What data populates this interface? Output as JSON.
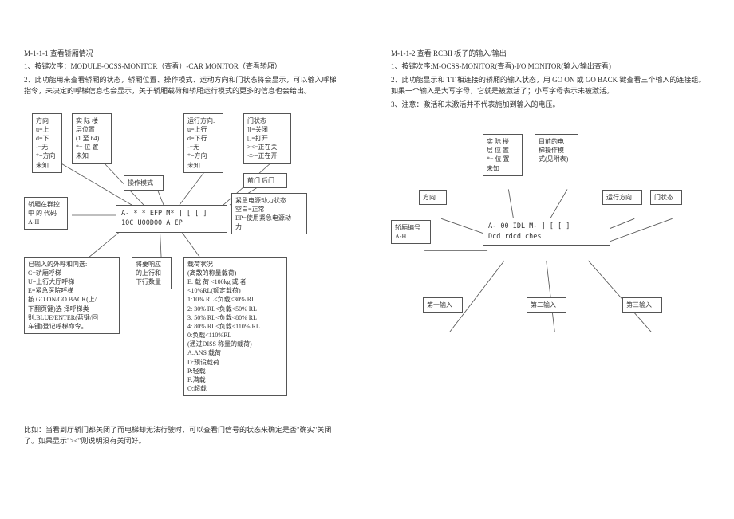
{
  "left": {
    "title": "M-1-1-1 查看轿厢情况",
    "line1": "1、按键次序：MODULE-OCSS-MONITOR（查看）-CAR MONITOR（查看轿厢）",
    "line2": "2、此功能用来查看轿厢的状态，轿厢位置、操作模式、运动方向和门状态将会显示，可以输入呼梯指令，未决定的呼梯信息也会显示，关于轿厢载荷和轿厢运行模式的更多的信息也会给出。",
    "box_direction": "方向\nu=上\nd=下\n-=无\n*=方向\n未知",
    "box_floor": "实 际 楼\n层位置\n(1 至 64)\n*= 位 置\n未知",
    "box_opmode": "操作模式",
    "box_rundir": "运行方向:\nu=上行\nd=下行\n-=无\n*=方向\n未知",
    "box_door": "门状态\n][=关闭\n[]=打开\n><=正在关\n<>=正在开",
    "box_doors": "前门  后门",
    "box_ep": "紧急电源动力状态\n空白=正常\nEP=使用紧急电源动\n力",
    "box_code": "轿厢在群控\n中 的 代码\nA-H",
    "center1": "A- * * EFP M* ] [   [ ]",
    "center2": "10C  U00D00  A  EP",
    "box_calls": "已输入的外呼和内选:\nC=轿厢呼梯\nU=上行大厅呼梯\nE=紧急医院呼梯\n按 GO ON/GO BACK(上/\n下翻页键)选 择呼梯类\n别;BLUE/ENTER(蓝键/回\n车键)登记呼梯命令。",
    "box_updown": "将要响应\n的上行和\n下行数量",
    "box_load": "载荷状况\n(离散的称量载荷)\nE: 载 荷 <100kg 或 者\n<10%RL(额定载荷)\n1:10% RL<负载<30% RL\n2: 30% RL<负载<50% RL\n3: 50% RL<负载<80% RL\n4: 80% RL<负载<110% RL\n0:负载<110%RL\n(通过DISS 称量的载荷)\nA:ANS 载荷\nD:预设载荷\nP:轻载\nF:满载\nO:超载",
    "footer": "比如：当看到厅轿门都关闭了而电梯却无法行驶时，可以查看门信号的状态来确定是否\"确实\"关闭了。如果显示\"><\"则说明没有关闭好。"
  },
  "right": {
    "title": "M-1-1-2 查看 RCBII 板子的输入/输出",
    "line1": "1、按键次序:M-OCSS-MONITOR(查看)-I/O MONITOR(输入/输出查看)",
    "line2": "2、此功能显示和 TT 相连接的轿厢的输入状态，用 GO ON 或 GO BACK 键查看三个输入的连接组。如果一个输入是大写字母，它就是被激活了；小写字母表示未被激活。",
    "line3": "3、注意：激活和未激活并不代表施加到输入的电压。",
    "box_floor": "实 际 楼\n层 位 置\n*= 位 置\n未知",
    "box_mode": "目前的电\n梯操作模\n式(见附表)",
    "box_dir": "方向",
    "box_rundir": "运行方向",
    "box_door": "门状态",
    "box_carid": "轿厢编号\nA-H",
    "center1": "A- 00  IDL  M-     ] [   [ ]",
    "center2": "Dcd     rdcd     ches",
    "box_in1": "第一输入",
    "box_in2": "第二输入",
    "box_in3": "第三输入"
  }
}
